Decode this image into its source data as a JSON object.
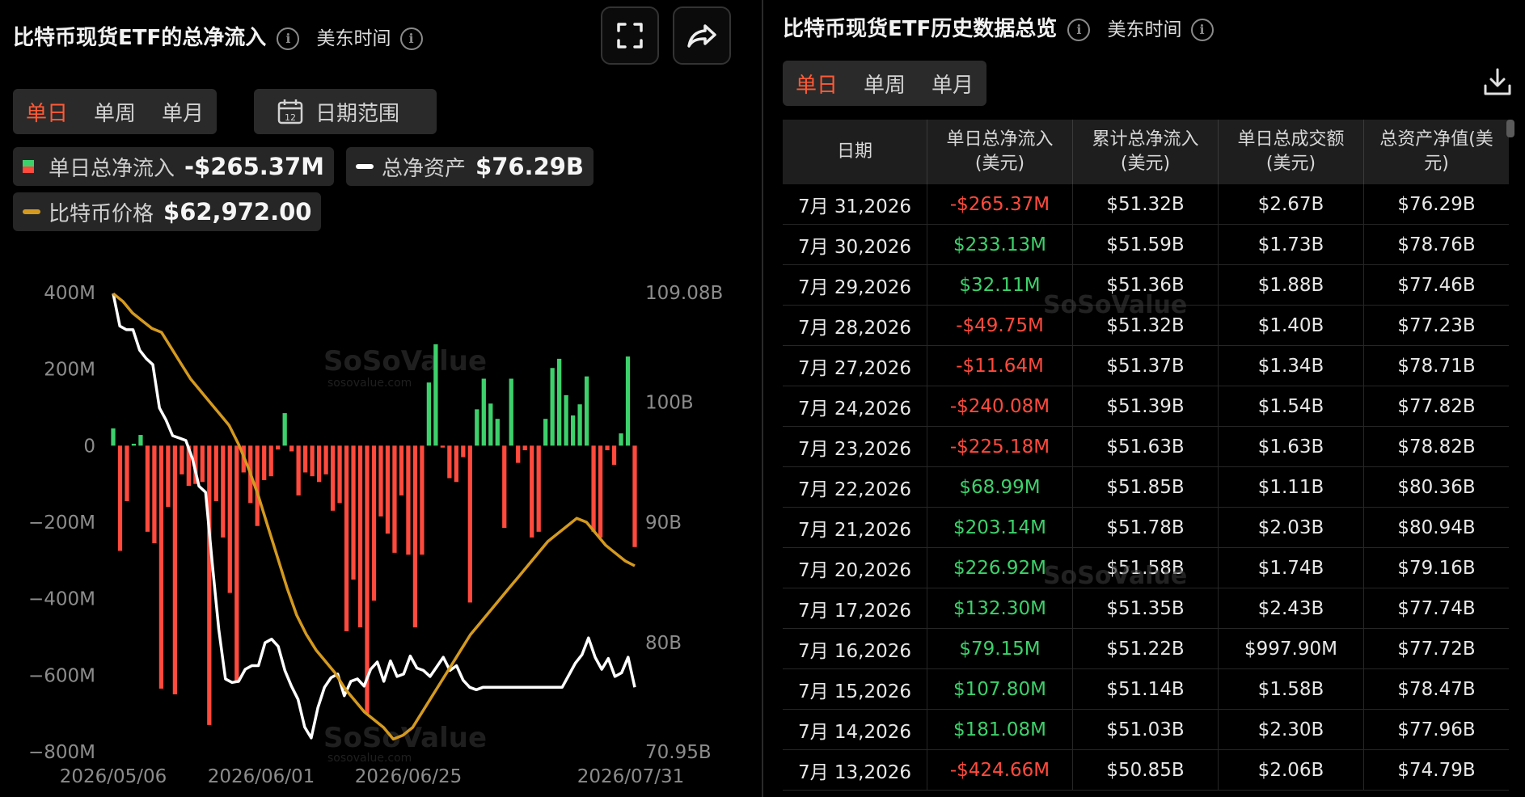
{
  "left": {
    "title": "比特币现货ETF的总净流入",
    "tz": "美东时间",
    "tabs": [
      "单日",
      "单周",
      "单月"
    ],
    "date_range": "日期范围",
    "calendar_day": "12",
    "legend": {
      "flow_label": "单日总净流入",
      "flow_value": "-$265.37M",
      "assets_label": "总净资产",
      "assets_value": "$76.29B",
      "price_label": "比特币价格",
      "price_value": "$62,972.00"
    }
  },
  "right": {
    "title": "比特币现货ETF历史数据总览",
    "tz": "美东时间",
    "tabs": [
      "单日",
      "单周",
      "单月"
    ],
    "headers": [
      [
        "日期"
      ],
      [
        "单日总净流入",
        "(美元)"
      ],
      [
        "累计总净流入",
        "(美元)"
      ],
      [
        "单日总成交额",
        "(美元)"
      ],
      [
        "总资产净值(美",
        "元)"
      ]
    ],
    "rows": [
      [
        "7月 31,2026",
        "-$265.37M",
        "$51.32B",
        "$2.67B",
        "$76.29B"
      ],
      [
        "7月 30,2026",
        "$233.13M",
        "$51.59B",
        "$1.73B",
        "$78.76B"
      ],
      [
        "7月 29,2026",
        "$32.11M",
        "$51.36B",
        "$1.88B",
        "$77.46B"
      ],
      [
        "7月 28,2026",
        "-$49.75M",
        "$51.32B",
        "$1.40B",
        "$77.23B"
      ],
      [
        "7月 27,2026",
        "-$11.64M",
        "$51.37B",
        "$1.34B",
        "$78.71B"
      ],
      [
        "7月 24,2026",
        "-$240.08M",
        "$51.39B",
        "$1.54B",
        "$77.82B"
      ],
      [
        "7月 23,2026",
        "-$225.18M",
        "$51.63B",
        "$1.63B",
        "$78.82B"
      ],
      [
        "7月 22,2026",
        "$68.99M",
        "$51.85B",
        "$1.11B",
        "$80.36B"
      ],
      [
        "7月 21,2026",
        "$203.14M",
        "$51.78B",
        "$2.03B",
        "$80.94B"
      ],
      [
        "7月 20,2026",
        "$226.92M",
        "$51.58B",
        "$1.74B",
        "$79.16B"
      ],
      [
        "7月 17,2026",
        "$132.30M",
        "$51.35B",
        "$2.43B",
        "$77.74B"
      ],
      [
        "7月 16,2026",
        "$79.15M",
        "$51.22B",
        "$997.90M",
        "$77.72B"
      ],
      [
        "7月 15,2026",
        "$107.80M",
        "$51.14B",
        "$1.58B",
        "$78.47B"
      ],
      [
        "7月 14,2026",
        "$181.08M",
        "$51.03B",
        "$2.30B",
        "$77.96B"
      ],
      [
        "7月 13,2026",
        "-$424.66M",
        "$50.85B",
        "$2.06B",
        "$74.79B"
      ]
    ]
  },
  "watermark": {
    "brand": "SoSoValue",
    "url": "sosovalue.com"
  },
  "colors": {
    "inflow": "#3dd16b",
    "outflow": "#ff4a3d",
    "assets_line": "#ffffff",
    "price_line": "#d49a1f",
    "active_tab": "#ff5a36"
  },
  "chart_data": {
    "type": "bar",
    "title": "比特币现货ETF的总净流入",
    "x_tick_labels": [
      "2026/05/06",
      "2026/06/01",
      "2026/06/25",
      "2026/07/31"
    ],
    "y_left_ticks": [
      "400M",
      "200M",
      "0",
      "−200M",
      "−400M",
      "−600M",
      "−800M"
    ],
    "y_left_range": [
      -800,
      400
    ],
    "y_right_ticks": [
      "109.08B",
      "100B",
      "90B",
      "80B",
      "70.95B"
    ],
    "y_right_range": [
      70.95,
      109.08
    ],
    "grid": false,
    "series": [
      {
        "name": "单日总净流入",
        "unit": "M USD",
        "type": "bar",
        "values": [
          45,
          -275,
          -145,
          5,
          28,
          -225,
          -255,
          -635,
          -160,
          -650,
          -75,
          -105,
          -100,
          -95,
          -730,
          -145,
          -240,
          -385,
          -620,
          -70,
          -150,
          -210,
          -90,
          -80,
          -10,
          85,
          -15,
          -130,
          -70,
          -80,
          -95,
          -75,
          -170,
          -150,
          -485,
          -350,
          -475,
          -700,
          -405,
          -185,
          -230,
          -280,
          -130,
          -285,
          -475,
          -285,
          165,
          265,
          -5,
          -85,
          -95,
          -30,
          -410,
          95,
          175,
          110,
          70,
          -215,
          175,
          -45,
          -12,
          -240,
          -225,
          70,
          203,
          227,
          132,
          79,
          108,
          181,
          -225,
          -240,
          -12,
          -50,
          32,
          233,
          -265
        ]
      },
      {
        "name": "总净资产",
        "unit": "B USD",
        "type": "line",
        "values": [
          109.0,
          106.3,
          106.0,
          106.0,
          104.3,
          103.6,
          103.1,
          99.5,
          98.5,
          97.2,
          97.0,
          96.8,
          95.3,
          93.0,
          92.5,
          86.6,
          81.1,
          77.0,
          76.7,
          76.8,
          77.8,
          78.1,
          78.1,
          80.0,
          80.3,
          79.7,
          77.7,
          76.4,
          75.3,
          73.0,
          72.1,
          74.6,
          76.3,
          77.1,
          77.4,
          75.6,
          76.8,
          77.0,
          76.4,
          77.8,
          78.4,
          76.8,
          78.5,
          77.2,
          77.4,
          78.9,
          77.9,
          77.7,
          77.2,
          78.0,
          78.8,
          77.7,
          78.1,
          76.9,
          76.3,
          76.1,
          76.3,
          76.3,
          76.3,
          76.3,
          76.3,
          76.3,
          76.3,
          76.3,
          76.3,
          76.3,
          76.3,
          76.3,
          76.3,
          77.3,
          78.3,
          79.0,
          80.4,
          78.8,
          77.8,
          78.7,
          77.2,
          77.5,
          78.8,
          76.3
        ]
      },
      {
        "name": "比特币价格",
        "unit": "USD",
        "type": "line",
        "values": [
          70000,
          69800,
          69500,
          69300,
          69100,
          69000,
          68600,
          68200,
          67800,
          67500,
          67200,
          66900,
          66600,
          66100,
          65500,
          64800,
          64000,
          63200,
          62400,
          61700,
          61200,
          60800,
          60500,
          60200,
          59800,
          59500,
          59200,
          59000,
          58800,
          58500,
          58600,
          58800,
          59200,
          59600,
          60000,
          60400,
          60800,
          61200,
          61500,
          61800,
          62100,
          62400,
          62700,
          63000,
          63300,
          63600,
          63800,
          64000,
          64200,
          64100,
          63800,
          63500,
          63300,
          63100,
          62972
        ]
      }
    ]
  }
}
